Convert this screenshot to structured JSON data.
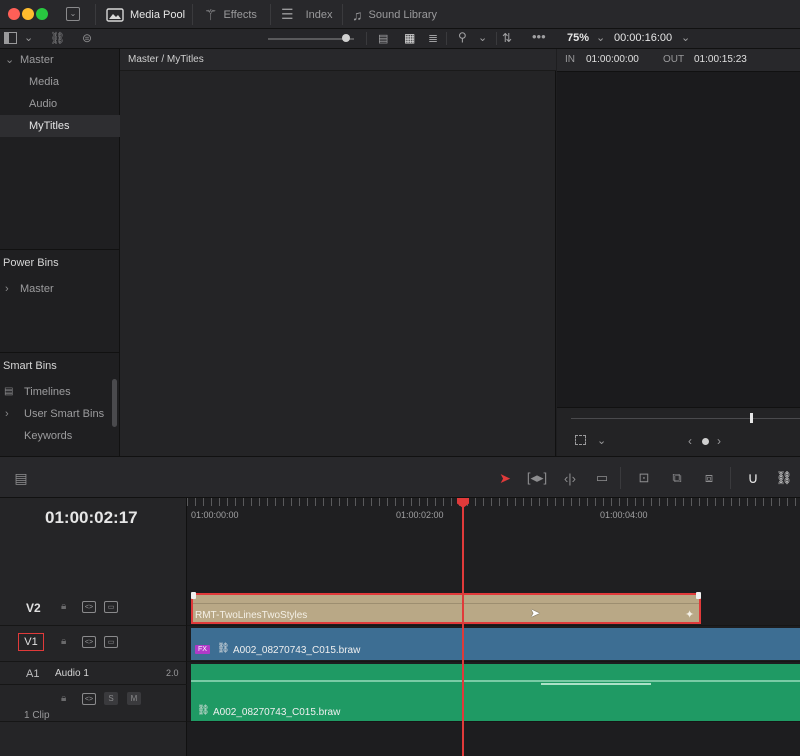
{
  "toolbar": {
    "media_pool": "Media Pool",
    "effects": "Effects",
    "index": "Index",
    "sound_library": "Sound Library"
  },
  "viewer": {
    "zoom": "75%",
    "duration": "00:00:16:00",
    "in_label": "IN",
    "in_tc": "01:00:00:00",
    "out_label": "OUT",
    "out_tc": "01:00:15:23"
  },
  "sidebar": {
    "master": "Master",
    "items": [
      "Media",
      "Audio",
      "MyTitles"
    ],
    "power_bins": "Power Bins",
    "power_master": "Master",
    "smart_bins": "Smart Bins",
    "smart_items": [
      "Timelines",
      "User Smart Bins",
      "Keywords"
    ]
  },
  "pool": {
    "breadcrumb": "Master / MyTitles"
  },
  "timeline": {
    "timecode": "01:00:02:17",
    "ruler": [
      "01:00:00:00",
      "01:00:02:00",
      "01:00:04:00"
    ],
    "tracks": {
      "v2": "V2",
      "v1": "V1",
      "a1": "A1",
      "audio_name": "Audio 1",
      "audio_ch": "2.0",
      "solo": "S",
      "mute": "M",
      "clip_count": "1 Clip"
    },
    "clips": {
      "title": "RMT-TwoLinesTwoStyles",
      "video": "A002_08270743_C015.braw",
      "video_badge": "FX",
      "audio": "A002_08270743_C015.braw"
    }
  },
  "colors": {
    "accent_red": "#e03a3a",
    "title_clip": "#b9a886",
    "video_clip": "#3d6e93",
    "audio_clip": "#1f9a64"
  }
}
